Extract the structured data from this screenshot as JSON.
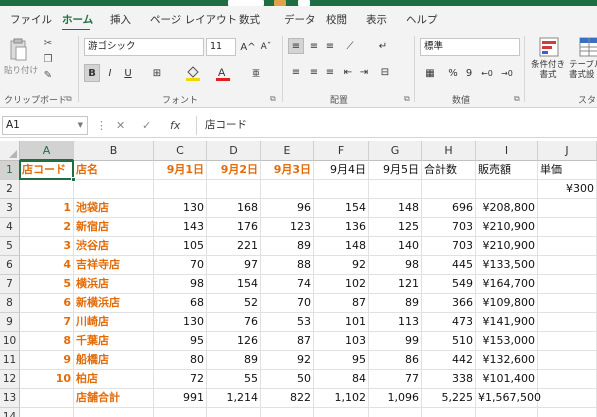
{
  "ribbon_tabs": [
    "ファイル",
    "ホーム",
    "挿入",
    "ページ レイアウト",
    "数式",
    "データ",
    "校閲",
    "表示",
    "ヘルプ"
  ],
  "active_tab": "ホーム",
  "clipboard": {
    "paste_label": "貼り付け",
    "group_label": "クリップボード"
  },
  "font": {
    "family": "游ゴシック",
    "size": "11",
    "grow_icon": "A^",
    "shrink_icon": "Aˇ",
    "bold": "B",
    "italic": "I",
    "underline": "U",
    "group_label": "フォント"
  },
  "alignment": {
    "group_label": "配置"
  },
  "number": {
    "format": "標準",
    "percent": "%",
    "comma": "9",
    "group_label": "数値"
  },
  "styles": {
    "conditional_format_label": "条件付き\n書式",
    "table_format_label": "テーブル\n書式設",
    "group_label": "スタ"
  },
  "namebox": "A1",
  "fx_label": "fx",
  "formula_value": "店コード",
  "active_cell": "A1",
  "columns": [
    "A",
    "B",
    "C",
    "D",
    "E",
    "F",
    "G",
    "H",
    "I",
    "J"
  ],
  "row_numbers": [
    "1",
    "2",
    "3",
    "4",
    "5",
    "6",
    "7",
    "8",
    "9",
    "10",
    "11",
    "12",
    "13",
    "14"
  ],
  "header_row": [
    "店コード",
    "店名",
    "9月1日",
    "9月2日",
    "9月3日",
    "9月4日",
    "9月5日",
    "合計数",
    "販売額",
    "単価"
  ],
  "row2": [
    "",
    "",
    "",
    "",
    "",
    "",
    "",
    "",
    "",
    "¥300"
  ],
  "data_rows": [
    [
      "1",
      "池袋店",
      "130",
      "168",
      "96",
      "154",
      "148",
      "696",
      "¥208,800",
      ""
    ],
    [
      "2",
      "新宿店",
      "143",
      "176",
      "123",
      "136",
      "125",
      "703",
      "¥210,900",
      ""
    ],
    [
      "3",
      "渋谷店",
      "105",
      "221",
      "89",
      "148",
      "140",
      "703",
      "¥210,900",
      ""
    ],
    [
      "4",
      "吉祥寺店",
      "70",
      "97",
      "88",
      "92",
      "98",
      "445",
      "¥133,500",
      ""
    ],
    [
      "5",
      "横浜店",
      "98",
      "154",
      "74",
      "102",
      "121",
      "549",
      "¥164,700",
      ""
    ],
    [
      "6",
      "新横浜店",
      "68",
      "52",
      "70",
      "87",
      "89",
      "366",
      "¥109,800",
      ""
    ],
    [
      "7",
      "川崎店",
      "130",
      "76",
      "53",
      "101",
      "113",
      "473",
      "¥141,900",
      ""
    ],
    [
      "8",
      "千葉店",
      "95",
      "126",
      "87",
      "103",
      "99",
      "510",
      "¥153,000",
      ""
    ],
    [
      "9",
      "船橋店",
      "80",
      "89",
      "92",
      "95",
      "86",
      "442",
      "¥132,600",
      ""
    ],
    [
      "10",
      "柏店",
      "72",
      "55",
      "50",
      "84",
      "77",
      "338",
      "¥101,400",
      ""
    ]
  ],
  "total_row": [
    "",
    "店舗合計",
    "991",
    "1,214",
    "822",
    "1,102",
    "1,096",
    "5,225",
    "¥1,567,500",
    ""
  ],
  "colors": {
    "accent": "#1f6e43",
    "header_text": "#e36c09"
  }
}
